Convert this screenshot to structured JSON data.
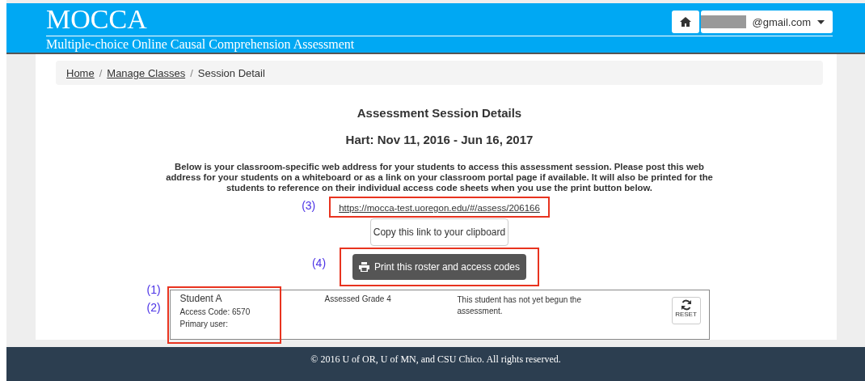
{
  "header": {
    "title": "MOCCA",
    "subtitle": "Multiple-choice Online Causal Comprehension Assessment",
    "user_email": "@gmail.com",
    "email_redacted": true
  },
  "breadcrumb_separator": "/",
  "breadcrumb": [
    {
      "label": "Home",
      "link": true
    },
    {
      "label": "Manage Classes",
      "link": true
    },
    {
      "label": "Session Detail",
      "link": false
    }
  ],
  "heading": "Assessment Session Details",
  "session": "Hart: Nov 11, 2016 - Jun 16, 2017",
  "description": "Below is your classroom-specific web address for your students to access this assessment session. Please post this web address for your students on a whiteboard or as a link on your classroom portal page if available. It will also be printed for the students to reference on their individual access code sheets when you use the print button below.",
  "session_link": "https://mocca-test.uoregon.edu/#/assess/206166",
  "copy_button": "Copy this link to your clipboard",
  "print_button": "Print this roster and access codes",
  "students": [
    {
      "name": "Student A",
      "access_code": "Access Code: 6570",
      "primary_user": "Primary user:",
      "grade": "Assessed Grade 4",
      "status": "This student has not yet begun the assessment.",
      "reset_label": "RESET"
    }
  ],
  "annotations": {
    "student_name": "(1)",
    "access_code": "(2)",
    "link": "(3)",
    "print": "(4)"
  },
  "footer": "© 2016 U of OR, U of MN, and CSU Chico. All rights reserved."
}
